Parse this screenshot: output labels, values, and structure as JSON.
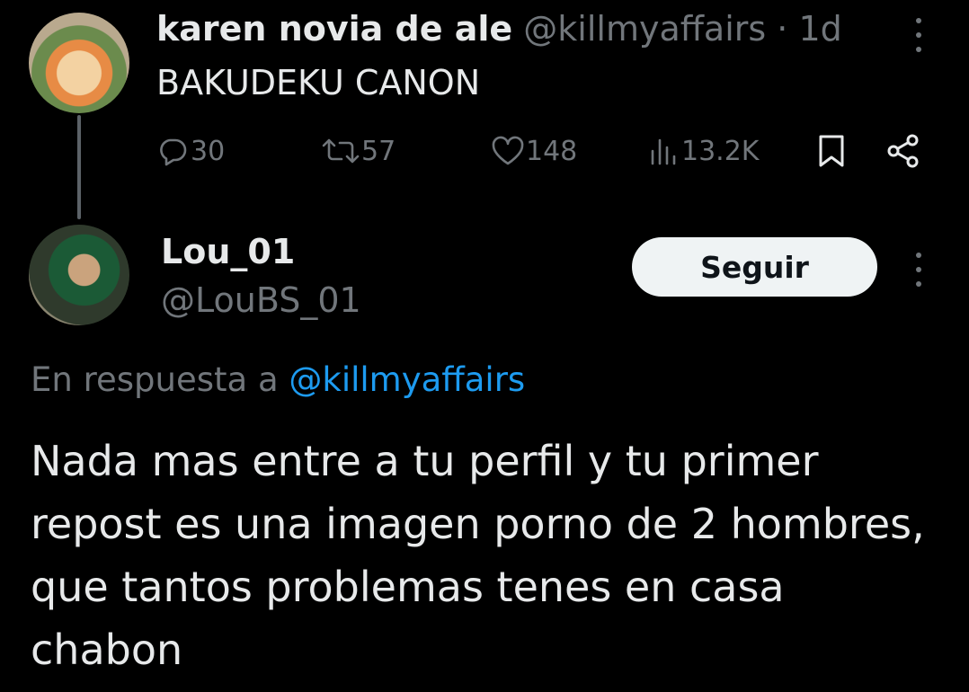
{
  "tweet1": {
    "display_name": "karen novia de ale",
    "handle": "@killmyaffairs",
    "separator": "·",
    "time": "1d",
    "text": "BAKUDEKU CANON",
    "stats": {
      "replies": "30",
      "reposts": "57",
      "likes": "148",
      "views": "13.2K"
    }
  },
  "tweet2": {
    "display_name": "Lou_01",
    "handle": "@LouBS_01",
    "follow_label": "Seguir",
    "reply_prefix": "En respuesta a",
    "reply_mention": "@killmyaffairs",
    "text": "Nada mas entre a tu perfil y tu primer repost es una imagen porno de 2 hombres, que tantos problemas tenes en casa chabon"
  },
  "colors": {
    "background": "#000000",
    "primary_text": "#e7e9ea",
    "secondary_text": "#71767b",
    "link": "#1d9bf0",
    "follow_button_bg": "#eff3f4"
  },
  "icons": [
    "more-icon",
    "reply-icon",
    "repost-icon",
    "like-icon",
    "views-icon",
    "bookmark-icon",
    "share-icon"
  ]
}
